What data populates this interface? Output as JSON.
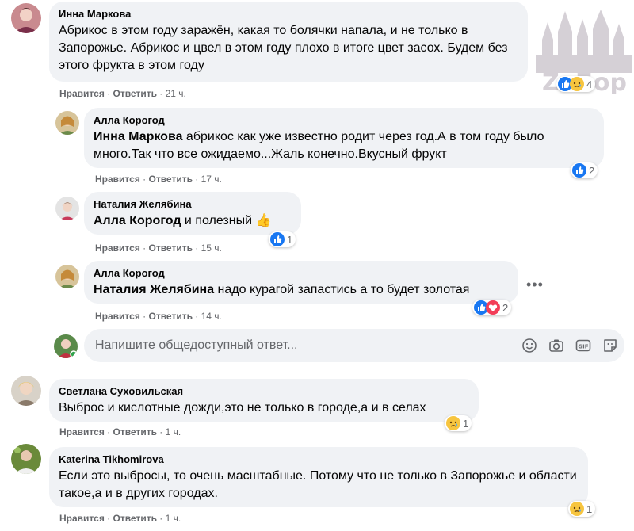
{
  "comments": [
    {
      "author": "Инна Маркова",
      "text": "Абрикос в этом году заражён, какая то болячки напала, и не только в Запорожье. Абрикос и цвел в этом году плохо в итоге цвет засох. Будем без этого фрукта в этом году",
      "like": "Нравится",
      "reply": "Ответить",
      "time": "21 ч.",
      "reaction_count": "4",
      "reactions": [
        "like-icon",
        "sad-icon"
      ]
    },
    {
      "author": "Алла Корогод",
      "mention": "Инна Маркова",
      "text": " абрикос как уже известно родит через год.А в том году было много.Так что все ожидаемо...Жаль конечно.Вкусный фрукт",
      "like": "Нравится",
      "reply": "Ответить",
      "time": "17 ч.",
      "reaction_count": "2",
      "reactions": [
        "like-icon"
      ]
    },
    {
      "author": "Наталия Желябина",
      "mention": "Алла Корогод",
      "text": " и полезный 👍",
      "like": "Нравится",
      "reply": "Ответить",
      "time": "15 ч.",
      "reaction_count": "1",
      "reactions": [
        "like-icon"
      ]
    },
    {
      "author": "Алла Корогод",
      "mention": "Наталия Желябина",
      "text": " надо курагой запастись а то будет золотая",
      "like": "Нравится",
      "reply": "Ответить",
      "time": "14 ч.",
      "reaction_count": "2",
      "reactions": [
        "like-icon",
        "heart-icon"
      ]
    },
    {
      "author": "Светлана Суховильская",
      "text": "Выброс и кислотные дожди,это не только в городе,а и в селах",
      "like": "Нравится",
      "reply": "Ответить",
      "time": "1 ч.",
      "reaction_count": "1",
      "reactions": [
        "sad-icon"
      ]
    },
    {
      "author": "Katerina Tikhomirova",
      "text": "Если это выбросы, то очень масштабные. Потому что не только в Запорожье и области такое,а и в других городах.",
      "like": "Нравится",
      "reply": "Ответить",
      "time": "1 ч.",
      "reaction_count": "1",
      "reactions": [
        "sad-icon"
      ]
    }
  ],
  "reply_box": {
    "placeholder": "Напишите общедоступный ответ...",
    "tools": [
      "emoji-icon",
      "camera-icon",
      "gif-icon",
      "sticker-icon"
    ]
  },
  "more_options": "•••",
  "watermark": "ZaБор",
  "colors": {
    "bubble": "#f0f2f5",
    "meta": "#65676b",
    "like": "#1877f2",
    "heart": "#f33e58",
    "sad": "#f7c53f"
  }
}
